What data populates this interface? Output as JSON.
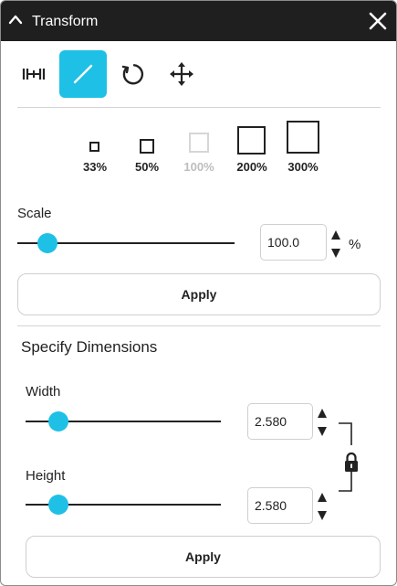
{
  "window": {
    "title": "Transform"
  },
  "tools": [
    {
      "icon": "resize-icon",
      "active": false
    },
    {
      "icon": "scale-diagonal-icon",
      "active": true
    },
    {
      "icon": "rotate-icon",
      "active": false
    },
    {
      "icon": "move-icon",
      "active": false
    }
  ],
  "presets": [
    {
      "label": "33%",
      "enabled": true
    },
    {
      "label": "50%",
      "enabled": true
    },
    {
      "label": "100%",
      "enabled": false
    },
    {
      "label": "200%",
      "enabled": true
    },
    {
      "label": "300%",
      "enabled": true
    }
  ],
  "scale": {
    "label": "Scale",
    "value": "100.0",
    "unit": "%",
    "slider_fraction": 0.14,
    "apply_label": "Apply"
  },
  "dimensions": {
    "section_title": "Specify Dimensions",
    "width": {
      "label": "Width",
      "value": "2.580",
      "slider_fraction": 0.17
    },
    "height": {
      "label": "Height",
      "value": "2.580",
      "slider_fraction": 0.17
    },
    "aspect_lock_icon": "lock-icon",
    "apply_label": "Apply"
  },
  "colors": {
    "accent": "#1ec0e6",
    "titlebar": "#1f1f1f"
  }
}
